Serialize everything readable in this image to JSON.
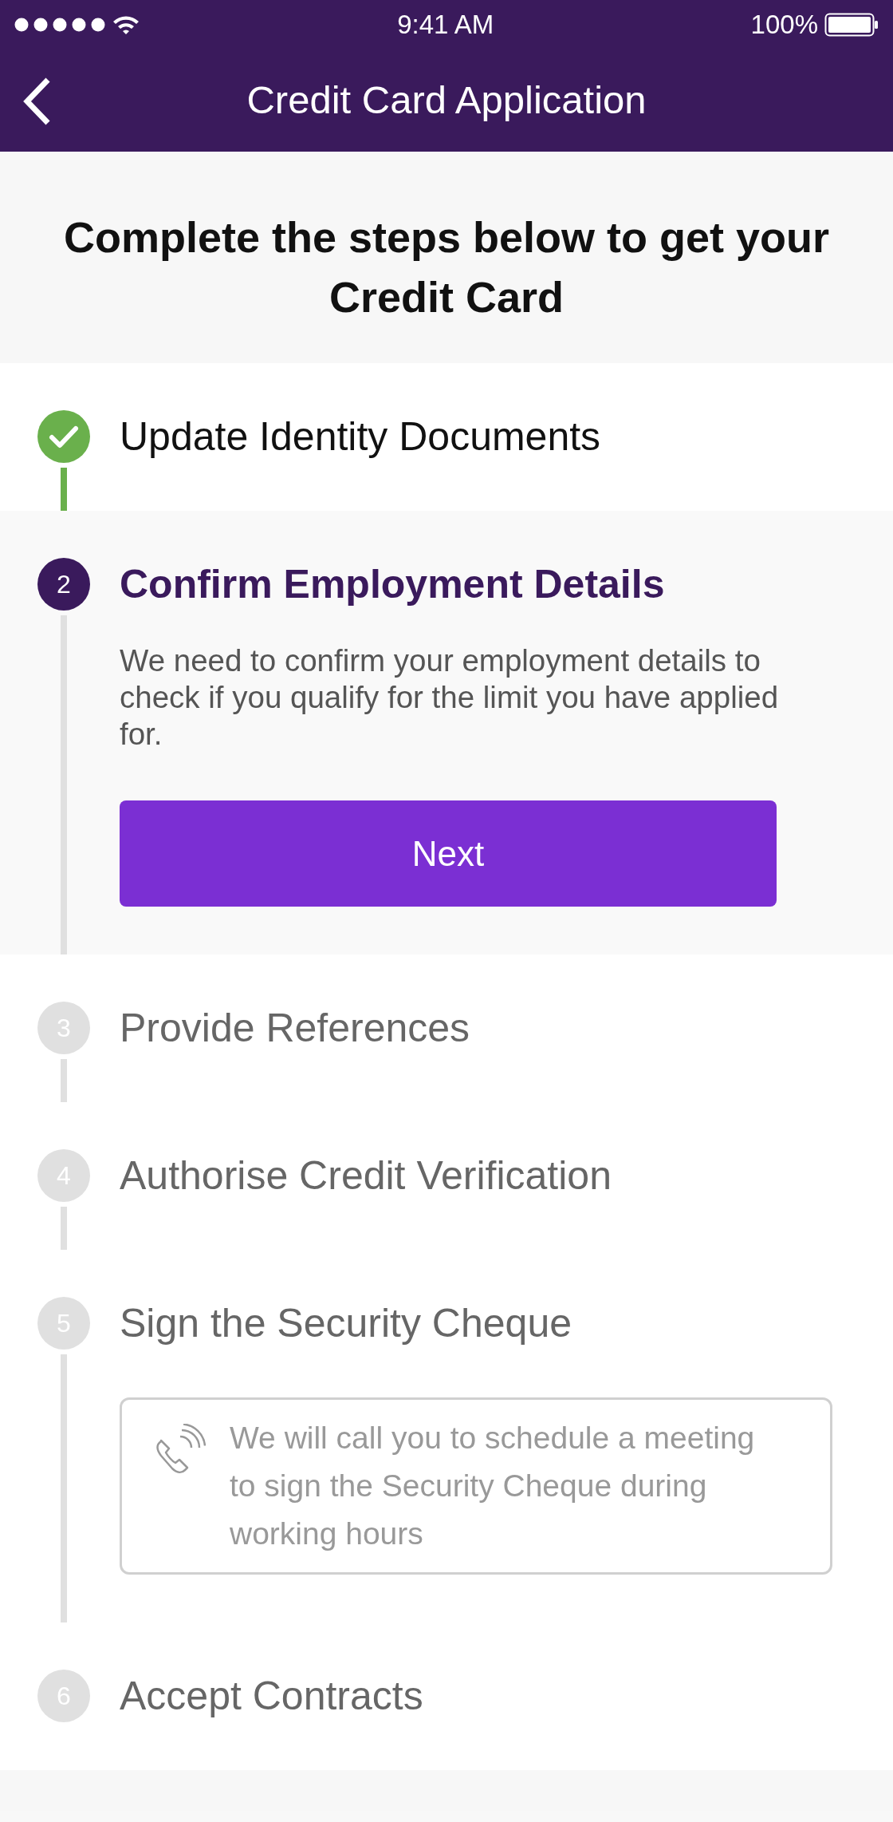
{
  "status_bar": {
    "time": "9:41 AM",
    "battery": "100%"
  },
  "nav_bar": {
    "title": "Credit Card Application"
  },
  "intro": {
    "title": "Complete the steps below to get your Credit Card"
  },
  "steps": [
    {
      "title": "Update Identity Documents",
      "completed": true,
      "selected": false
    },
    {
      "number": "2",
      "title": "Confirm Employment Details",
      "completed": false,
      "selected": true,
      "description": "We need to confirm your employment details to check if you qualify for the limit you have applied for.",
      "button": "Next"
    },
    {
      "number": "3",
      "title": "Provide References",
      "completed": false,
      "selected": false
    },
    {
      "number": "4",
      "title": "Authorise Credit Verification",
      "completed": false,
      "selected": false
    },
    {
      "number": "5",
      "title": "Sign the Security Cheque",
      "completed": false,
      "selected": false,
      "note": "We will call you to schedule a meeting to sign the Security Cheque during working hours"
    },
    {
      "number": "6",
      "title": "Accept Contracts",
      "completed": false,
      "selected": false
    }
  ]
}
